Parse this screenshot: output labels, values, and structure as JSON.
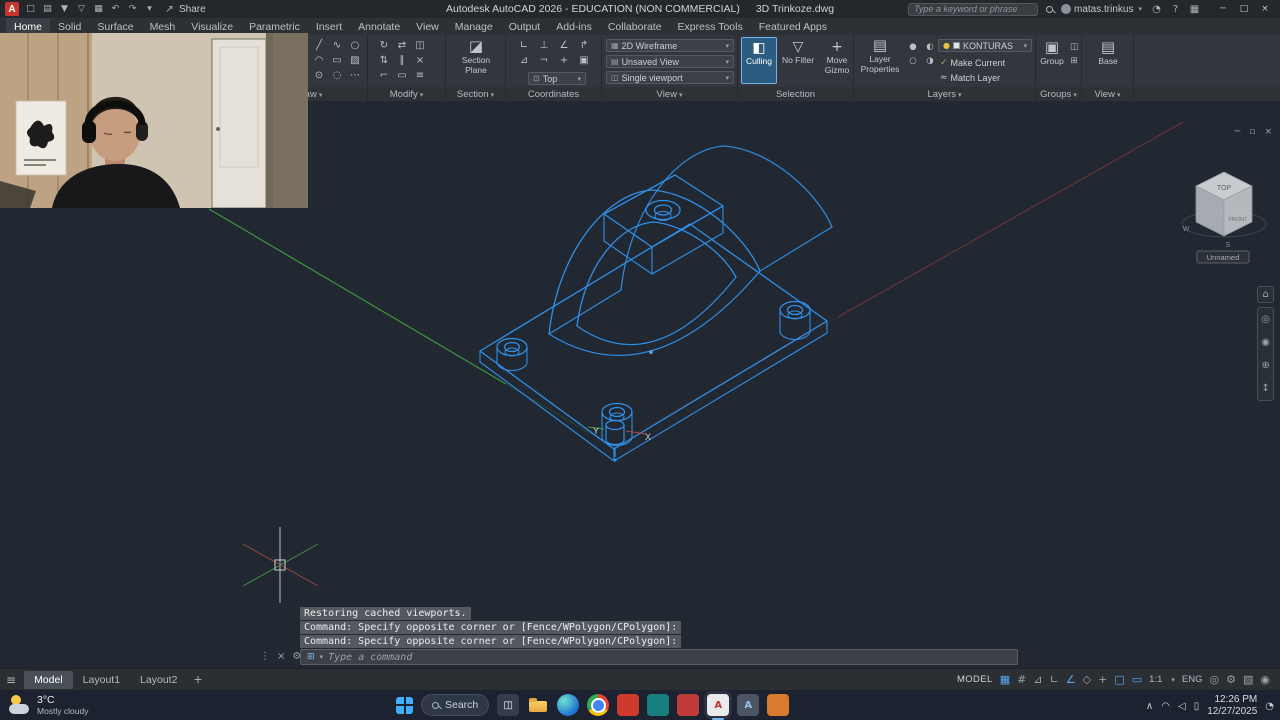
{
  "glyphs": {
    "caret": "▾",
    "hamburger": "≡",
    "share": "↗",
    "add": "+",
    "prompt": "⊞"
  },
  "titlebar": {
    "app_initial": "A",
    "quick_access": [
      {
        "name": "new-file",
        "glyph": "□"
      },
      {
        "name": "open-file",
        "glyph": "▤"
      },
      {
        "name": "save",
        "glyph": "▼"
      },
      {
        "name": "save-as",
        "glyph": "▽"
      },
      {
        "name": "plot",
        "glyph": "▦"
      },
      {
        "name": "undo",
        "glyph": "↶"
      },
      {
        "name": "redo",
        "glyph": "↷"
      },
      {
        "name": "customize-menu",
        "glyph": "▾"
      }
    ],
    "share_label": "Share",
    "title_app": "Autodesk AutoCAD 2026 - EDUCATION (NON COMMERCIAL)",
    "title_doc": "3D Trinkoze.dwg",
    "search_placeholder": "Type a keyword or phrase",
    "username": "matas.trinkus",
    "right_icons": [
      {
        "name": "notifications",
        "glyph": "◔"
      },
      {
        "name": "help",
        "glyph": "?"
      },
      {
        "name": "app-grid",
        "glyph": "▦"
      }
    ],
    "window_controls": [
      {
        "name": "minimize",
        "glyph": "─"
      },
      {
        "name": "maximize",
        "glyph": "□"
      },
      {
        "name": "close",
        "glyph": "×"
      }
    ]
  },
  "ribbon": {
    "tabs": [
      {
        "name": "home",
        "label": "Home",
        "active": true
      },
      {
        "name": "solid",
        "label": "Solid"
      },
      {
        "name": "surface",
        "label": "Surface"
      },
      {
        "name": "mesh",
        "label": "Mesh"
      },
      {
        "name": "visualize",
        "label": "Visualize"
      },
      {
        "name": "parametric",
        "label": "Parametric"
      },
      {
        "name": "insert",
        "label": "Insert"
      },
      {
        "name": "annotate",
        "label": "Annotate"
      },
      {
        "name": "view",
        "label": "View"
      },
      {
        "name": "manage",
        "label": "Manage"
      },
      {
        "name": "output",
        "label": "Output"
      },
      {
        "name": "addins",
        "label": "Add-ins"
      },
      {
        "name": "collaborate",
        "label": "Collaborate"
      },
      {
        "name": "express-tools",
        "label": "Express Tools"
      },
      {
        "name": "featured-apps",
        "label": "Featured Apps"
      }
    ],
    "draw": {
      "label": "Draw",
      "tools": [
        {
          "name": "line",
          "glyph": "╱"
        },
        {
          "name": "polyline",
          "glyph": "∿"
        },
        {
          "name": "circle",
          "glyph": "○"
        },
        {
          "name": "arc",
          "glyph": "◠"
        },
        {
          "name": "rectangle",
          "glyph": "▭"
        },
        {
          "name": "hatch",
          "glyph": "▨"
        },
        {
          "name": "point",
          "glyph": "⊙"
        },
        {
          "name": "ellipse",
          "glyph": "◌"
        },
        {
          "name": "more",
          "glyph": "⋯"
        }
      ]
    },
    "modify": {
      "label": "Modify",
      "tools": [
        {
          "name": "rotate",
          "glyph": "↻"
        },
        {
          "name": "move",
          "glyph": "⇄"
        },
        {
          "name": "copy",
          "glyph": "◫"
        },
        {
          "name": "stretch",
          "glyph": "⇅"
        },
        {
          "name": "offset",
          "glyph": "∥"
        },
        {
          "name": "erase",
          "glyph": "×"
        },
        {
          "name": "trim",
          "glyph": "⌐"
        },
        {
          "name": "fillet",
          "glyph": "▭"
        },
        {
          "name": "array",
          "glyph": "≡"
        }
      ]
    },
    "section": {
      "label": "Section",
      "button_label": "Section Plane",
      "icon": "◪"
    },
    "coordinates": {
      "label": "Coordinates",
      "tools": [
        {
          "name": "ucs",
          "glyph": "∟"
        },
        {
          "name": "ucs-world",
          "glyph": "⊥"
        },
        {
          "name": "ucs-z",
          "glyph": "∠"
        },
        {
          "name": "ucs-origin",
          "glyph": "↱"
        },
        {
          "name": "ucs-face",
          "glyph": "⊿"
        },
        {
          "name": "ucs-object",
          "glyph": "¬"
        },
        {
          "name": "ucs-view",
          "glyph": "+"
        },
        {
          "name": "ucs-named",
          "glyph": "▣"
        }
      ],
      "top_view": {
        "icon": "⊡",
        "label": "Top"
      }
    },
    "view": {
      "label": "View",
      "visual_style": {
        "icon": "▦",
        "label": "2D Wireframe"
      },
      "named_view": {
        "icon": "▤",
        "label": "Unsaved View"
      },
      "viewport": {
        "icon": "◫",
        "label": "Single viewport"
      }
    },
    "selection": {
      "label": "Selection",
      "buttons": [
        {
          "name": "culling",
          "icon": "◧",
          "label": "Culling",
          "active": true
        },
        {
          "name": "no-filter",
          "icon": "▽",
          "label": "No Filter"
        },
        {
          "name": "move-gizmo",
          "icon": "+",
          "label": "Move Gizmo"
        }
      ]
    },
    "layers": {
      "label": "Layers",
      "properties_label": "Layer Properties",
      "properties_icon": "▤",
      "state_tools": [
        {
          "name": "layer-on",
          "glyph": "●"
        },
        {
          "name": "layer-isolate",
          "glyph": "◐"
        },
        {
          "name": "layer-freeze",
          "glyph": "○"
        },
        {
          "name": "layer-lock",
          "glyph": "◑"
        }
      ],
      "current_layer": "KONTURAS",
      "make_current_label": "Make Current",
      "match_layer_label": "Match Layer",
      "match_icon": "≈"
    },
    "groups": {
      "label": "Groups",
      "group_icon": "▣",
      "group_label": "Group",
      "minis": [
        {
          "name": "ungroup",
          "glyph": "◫"
        },
        {
          "name": "group-edit",
          "glyph": "⊞"
        }
      ]
    },
    "view2": {
      "label": "View",
      "base_icon": "▤",
      "base_label": "Base"
    }
  },
  "canvas": {
    "window_controls": [
      {
        "name": "minimize-drawing",
        "glyph": "─"
      },
      {
        "name": "restore-drawing",
        "glyph": "▫"
      },
      {
        "name": "close-drawing",
        "glyph": "×"
      }
    ],
    "axis_y": "Y",
    "axis_x": "X",
    "viewcube": {
      "top": "TOP",
      "front": "FRONT",
      "west": "W",
      "south": "S",
      "view_label": "Unnamed"
    },
    "navbar": [
      {
        "name": "steering-wheel",
        "glyph": "◎"
      },
      {
        "name": "pan",
        "glyph": "◉"
      },
      {
        "name": "zoom",
        "glyph": "⊕"
      },
      {
        "name": "orbit",
        "glyph": "↕"
      }
    ]
  },
  "command_line": {
    "history": [
      "Restoring cached viewports.",
      "Command: Specify opposite corner or [Fence/WPolygon/CPolygon]:",
      "Command: Specify opposite corner or [Fence/WPolygon/CPolygon]:"
    ],
    "tools": [
      {
        "name": "command-grip",
        "glyph": "⋮"
      },
      {
        "name": "command-close",
        "glyph": "×"
      },
      {
        "name": "command-customize",
        "glyph": "⚙"
      }
    ],
    "placeholder": "Type a command"
  },
  "bottom_bar": {
    "tabs": [
      {
        "name": "model",
        "label": "Model",
        "active": true
      },
      {
        "name": "layout1",
        "label": "Layout1"
      },
      {
        "name": "layout2",
        "label": "Layout2"
      }
    ],
    "add_label": "+",
    "status_left": "MODEL",
    "icons_a": [
      {
        "name": "grid-display",
        "glyph": "▦",
        "active": true
      },
      {
        "name": "snap-mode",
        "glyph": "#"
      },
      {
        "name": "infer-constraints",
        "glyph": "⊿"
      },
      {
        "name": "ortho-mode",
        "glyph": "∟"
      },
      {
        "name": "polar-tracking",
        "glyph": "∠",
        "active": true
      },
      {
        "name": "isometric-drafting",
        "glyph": "◇"
      },
      {
        "name": "object-snap-tracking",
        "glyph": "+"
      },
      {
        "name": "object-snap",
        "glyph": "□",
        "active": true
      },
      {
        "name": "dynamic-input",
        "glyph": "▭",
        "active": true
      }
    ],
    "scale": "1:1",
    "lang": "ENG",
    "icons_b": [
      {
        "name": "annotation-monitor",
        "glyph": "◎"
      },
      {
        "name": "workspace-switching",
        "glyph": "⚙"
      },
      {
        "name": "graphics-performance",
        "glyph": "▧"
      },
      {
        "name": "isolate-objects",
        "glyph": "◉"
      }
    ]
  },
  "taskbar": {
    "weather": {
      "temp": "3°C",
      "desc": "Mostly cloudy"
    },
    "search_label": "Search",
    "apps": [
      {
        "name": "task-view",
        "color": "#343d4b",
        "letter": "◫"
      },
      {
        "name": "file-explorer",
        "color": "",
        "letter": ""
      },
      {
        "name": "edge",
        "color": "",
        "letter": ""
      },
      {
        "name": "chrome",
        "color": "",
        "letter": ""
      },
      {
        "name": "adobe-app",
        "color": "#cf3a2e",
        "letter": ""
      },
      {
        "name": "teal-app",
        "color": "#17807f",
        "letter": ""
      },
      {
        "name": "media-app",
        "color": "#c23b3b",
        "letter": ""
      },
      {
        "name": "autocad",
        "color": "#e9eaec",
        "letter": "A",
        "active": true
      },
      {
        "name": "autodesk-app",
        "color": "#4a5462",
        "letter": "A"
      },
      {
        "name": "orange-app",
        "color": "#d97b2c",
        "letter": ""
      }
    ],
    "tray": {
      "icons": [
        {
          "name": "tray-expand",
          "glyph": "∧"
        },
        {
          "name": "wifi",
          "glyph": "◠"
        },
        {
          "name": "volume",
          "glyph": "◁"
        },
        {
          "name": "battery",
          "glyph": "▯"
        }
      ],
      "time": "12:26 PM",
      "date": "12/27/2025",
      "notification_glyph": "◔"
    }
  }
}
